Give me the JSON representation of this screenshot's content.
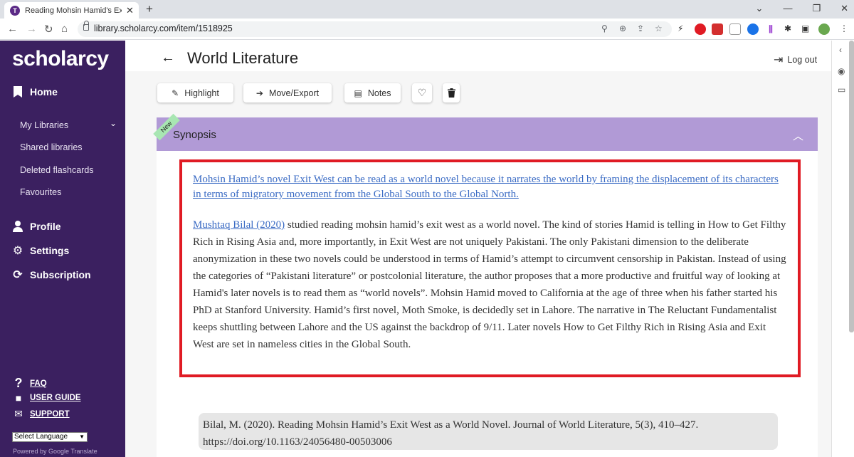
{
  "browser": {
    "tab_title": "Reading Mohsin Hamid's Exit We",
    "tab_favicon": "T",
    "url": "library.scholarcy.com/item/1518925",
    "new_tab": "+",
    "close": "✕"
  },
  "sidebar": {
    "brand": "scholarcy",
    "home": "Home",
    "libraries": [
      "My Libraries",
      "Shared libraries",
      "Deleted flashcards",
      "Favourites"
    ],
    "profile": "Profile",
    "settings": "Settings",
    "subscription": "Subscription",
    "faq": "FAQ",
    "user_guide": "USER GUIDE",
    "support": "SUPPORT",
    "language_select": "Select Language",
    "powered_by": "Powered by Google Translate"
  },
  "main": {
    "title": "World Literature",
    "logout": "Log out",
    "toolbar": {
      "highlight": "Highlight",
      "move_export": "Move/Export",
      "notes": "Notes"
    },
    "section": {
      "badge": "New",
      "title": "Synopsis"
    },
    "highlight_text": "Mohsin Hamid’s novel Exit West can be read as a world novel because it narrates the world by framing the displacement of its characters in terms of migratory movement from the Global South to the Global North.",
    "summary_link": "Mushtaq Bilal (2020)",
    "summary_text": " studied reading mohsin hamid’s exit west as a world novel. The kind of stories Hamid is telling in How to Get Filthy Rich in Rising Asia and, more importantly, in Exit West are not uniquely Pakistani. The only Pakistani dimension to the deliberate anonymization in these two novels could be understood in terms of Hamid’s attempt to circumvent censorship in Pakistan. Instead of using the categories of “Pakistani literature” or postcolonial literature, the author proposes that a more productive and fruitful way of looking at Hamid's later novels is to read them as “world novels”. Mohsin Hamid moved to California at the age of three when his father started his PhD at Stanford University. Hamid’s first novel, Moth Smoke, is decidedly set in Lahore. The narrative in The Reluctant Fundamentalist keeps shuttling between Lahore and the US against the backdrop of 9/11. Later novels How to Get Filthy Rich in Rising Asia and Exit West are set in nameless cities in the Global South.",
    "citation": "Bilal, M. (2020). Reading Mohsin Hamid’s Exit West as a World Novel. Journal of World Literature, 5(3), 410–427. https://doi.org/10.1163/24056480-00503006"
  },
  "colors": {
    "sidebar": "#3b2060",
    "synopsis_header": "#b19ad6",
    "highlight_box": "#e01b24",
    "link": "#3a6bc4"
  }
}
